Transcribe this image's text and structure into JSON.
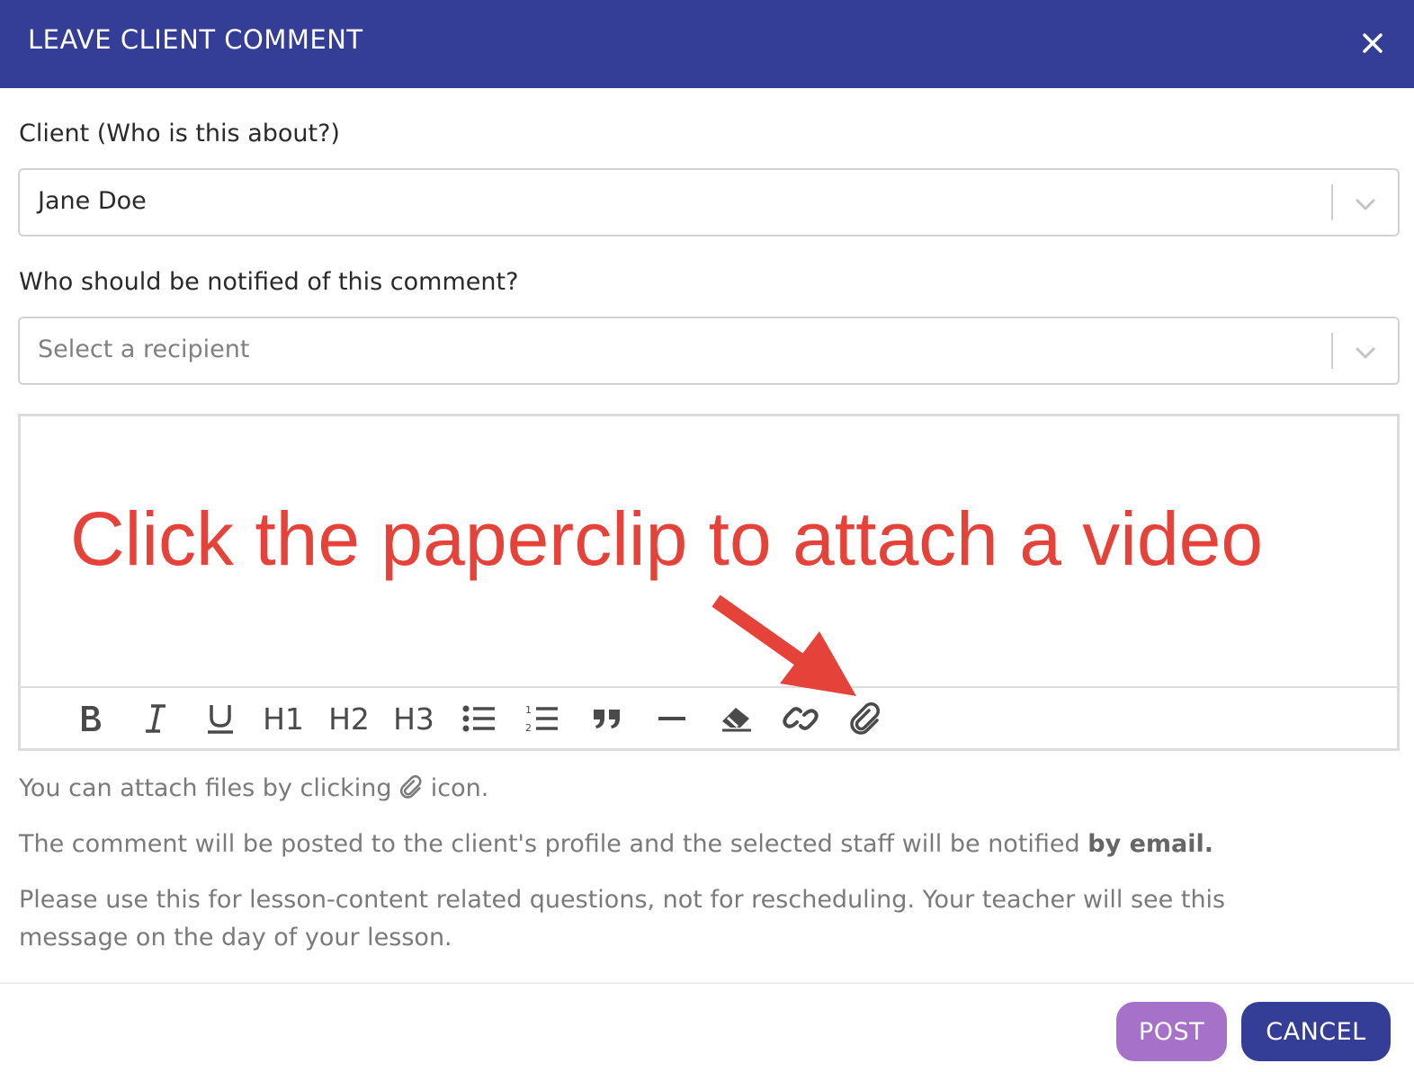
{
  "dialog": {
    "title": "LEAVE CLIENT COMMENT"
  },
  "client_field": {
    "label": "Client (Who is this about?)",
    "value": "Jane Doe"
  },
  "notify_field": {
    "label": "Who should be notified of this comment?",
    "placeholder": "Select a recipient"
  },
  "editor": {
    "annotation": "Click the paperclip to attach a video",
    "toolbar": {
      "h1": "H1",
      "h2": "H2",
      "h3": "H3",
      "icons": [
        "bold-icon",
        "italic-icon",
        "underline-icon",
        "bullet-list-icon",
        "numbered-list-icon",
        "quote-icon",
        "horizontal-rule-icon",
        "eraser-icon",
        "link-icon",
        "paperclip-icon"
      ]
    }
  },
  "help": {
    "attach_before": "You can attach files by clicking",
    "attach_after": "icon.",
    "posted_text": "The comment will be posted to the client's profile and the selected staff will be notified",
    "posted_bold": "by email.",
    "usage_text": "Please use this for lesson-content related questions, not for rescheduling.  Your teacher will see this message on the day of your lesson."
  },
  "buttons": {
    "post": "POST",
    "cancel": "CANCEL"
  },
  "colors": {
    "header": "#343e96",
    "post_button": "#a571c9",
    "cancel_button": "#343e96",
    "annotation": "#e5433a"
  }
}
